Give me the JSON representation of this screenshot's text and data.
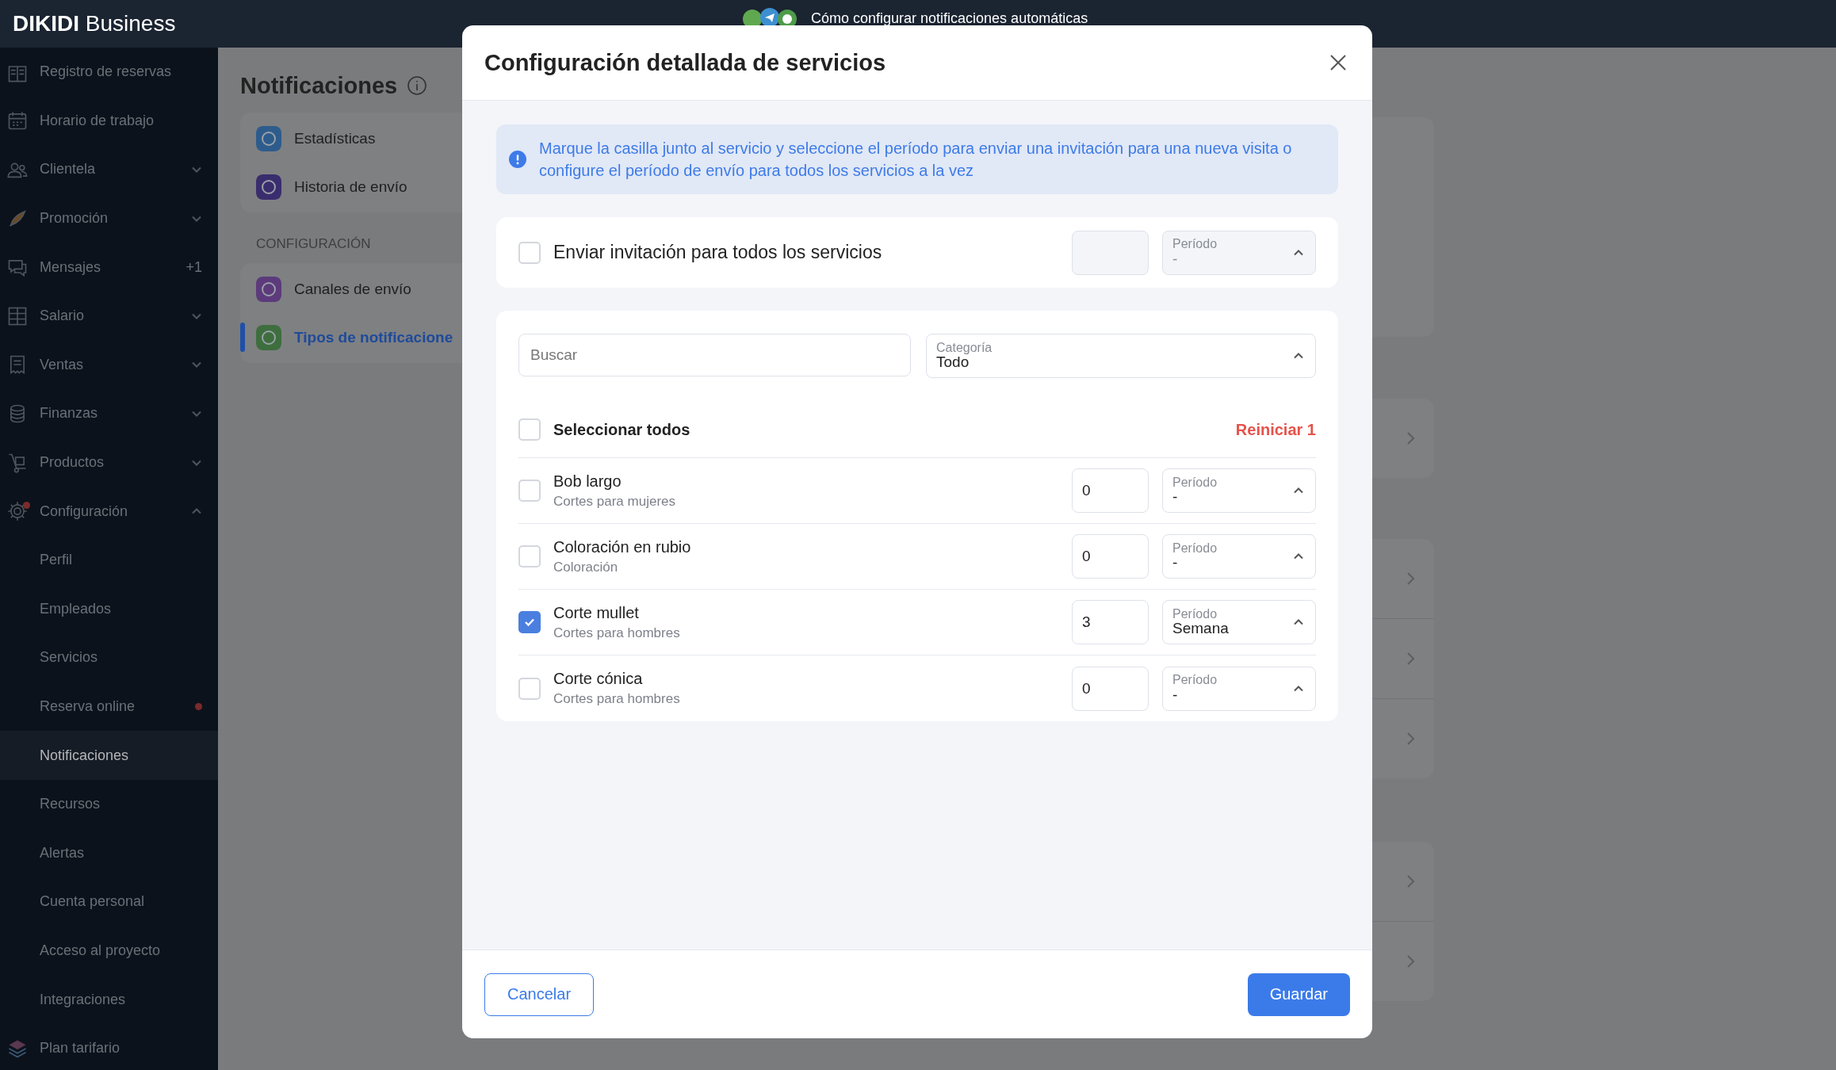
{
  "topbar": {
    "brand": "**DIKIDI** Business",
    "help_link": "Cómo configurar notificaciones automáticas"
  },
  "sidebar": {
    "items": [
      {
        "label": "Registro de reservas",
        "selected": false,
        "dot": false
      },
      {
        "label": "Horario de trabajo",
        "selected": false,
        "dot": false
      },
      {
        "label": "Clientela",
        "selected": false,
        "dot": false,
        "expanded": false
      },
      {
        "label": "Promoción",
        "selected": false,
        "dot": false,
        "expanded": false
      },
      {
        "label": "Mensajes",
        "selected": false,
        "dot": false,
        "badge": "+1"
      },
      {
        "label": "Salario",
        "selected": false,
        "dot": false,
        "expanded": false
      },
      {
        "label": "Ventas",
        "selected": false,
        "dot": false,
        "expanded": false
      },
      {
        "label": "Finanzas",
        "selected": false,
        "dot": false,
        "expanded": false
      },
      {
        "label": "Productos",
        "selected": false,
        "dot": false,
        "expanded": false
      },
      {
        "label": "Configuración",
        "selected": false,
        "dot": true,
        "expanded": true,
        "children": [
          {
            "label": "Perfil",
            "selected": false,
            "dot": false
          },
          {
            "label": "Empleados",
            "selected": false,
            "dot": false
          },
          {
            "label": "Servicios",
            "selected": false,
            "dot": false
          },
          {
            "label": "Reserva online",
            "selected": false,
            "dot": true
          },
          {
            "label": "Notificaciones",
            "selected": true,
            "dot": false
          },
          {
            "label": "Recursos",
            "selected": false,
            "dot": false
          },
          {
            "label": "Alertas",
            "selected": false,
            "dot": false
          },
          {
            "label": "Cuenta personal",
            "selected": false,
            "dot": false
          },
          {
            "label": "Acceso al proyecto",
            "selected": false,
            "dot": false
          },
          {
            "label": "Integraciones",
            "selected": false,
            "dot": false
          }
        ]
      },
      {
        "label": "Plan tarifario",
        "selected": false,
        "dot": false
      }
    ]
  },
  "page": {
    "title": "Notificaciones",
    "menu_groups": [
      {
        "items": [
          {
            "label": "Estadísticas",
            "selected": false
          },
          {
            "label": "Historia de envío",
            "selected": false
          }
        ]
      },
      {
        "heading": "CONFIGURACIÓN",
        "items": [
          {
            "label": "Canales de envío",
            "selected": false
          },
          {
            "label": "Tipos de notificacione",
            "selected": true
          }
        ]
      }
    ]
  },
  "modal": {
    "title": "Configuración detallada de servicios",
    "info": "Marque la casilla junto al servicio y seleccione el período para enviar una invitación para una nueva visita o configure el período de envío para todos los servicios a la vez",
    "all_services": {
      "label": "Enviar invitación para todos los servicios",
      "checked": false,
      "disabled": true,
      "period_label": "Período",
      "period": "-"
    },
    "search": {
      "placeholder": "Buscar"
    },
    "category": {
      "label": "Categoría",
      "value": "Todo"
    },
    "select_all": {
      "label": "Seleccionar todos",
      "checked": false
    },
    "reset": "Reiniciar 1",
    "services": [
      {
        "name": "Bob largo",
        "category": "Cortes para mujeres",
        "checked": false,
        "count": "0",
        "period_label": "Período",
        "period": "-"
      },
      {
        "name": "Coloración en rubio",
        "category": "Coloración",
        "checked": false,
        "count": "0",
        "period_label": "Período",
        "period": "-"
      },
      {
        "name": "Corte mullet",
        "category": "Cortes para hombres",
        "checked": true,
        "count": "3",
        "period_label": "Período",
        "period": "Semana"
      },
      {
        "name": "Corte cónica",
        "category": "Cortes para hombres",
        "checked": false,
        "count": "0",
        "period_label": "Período",
        "period": "-"
      }
    ],
    "buttons": {
      "cancel": "Cancelar",
      "save": "Guardar"
    }
  }
}
